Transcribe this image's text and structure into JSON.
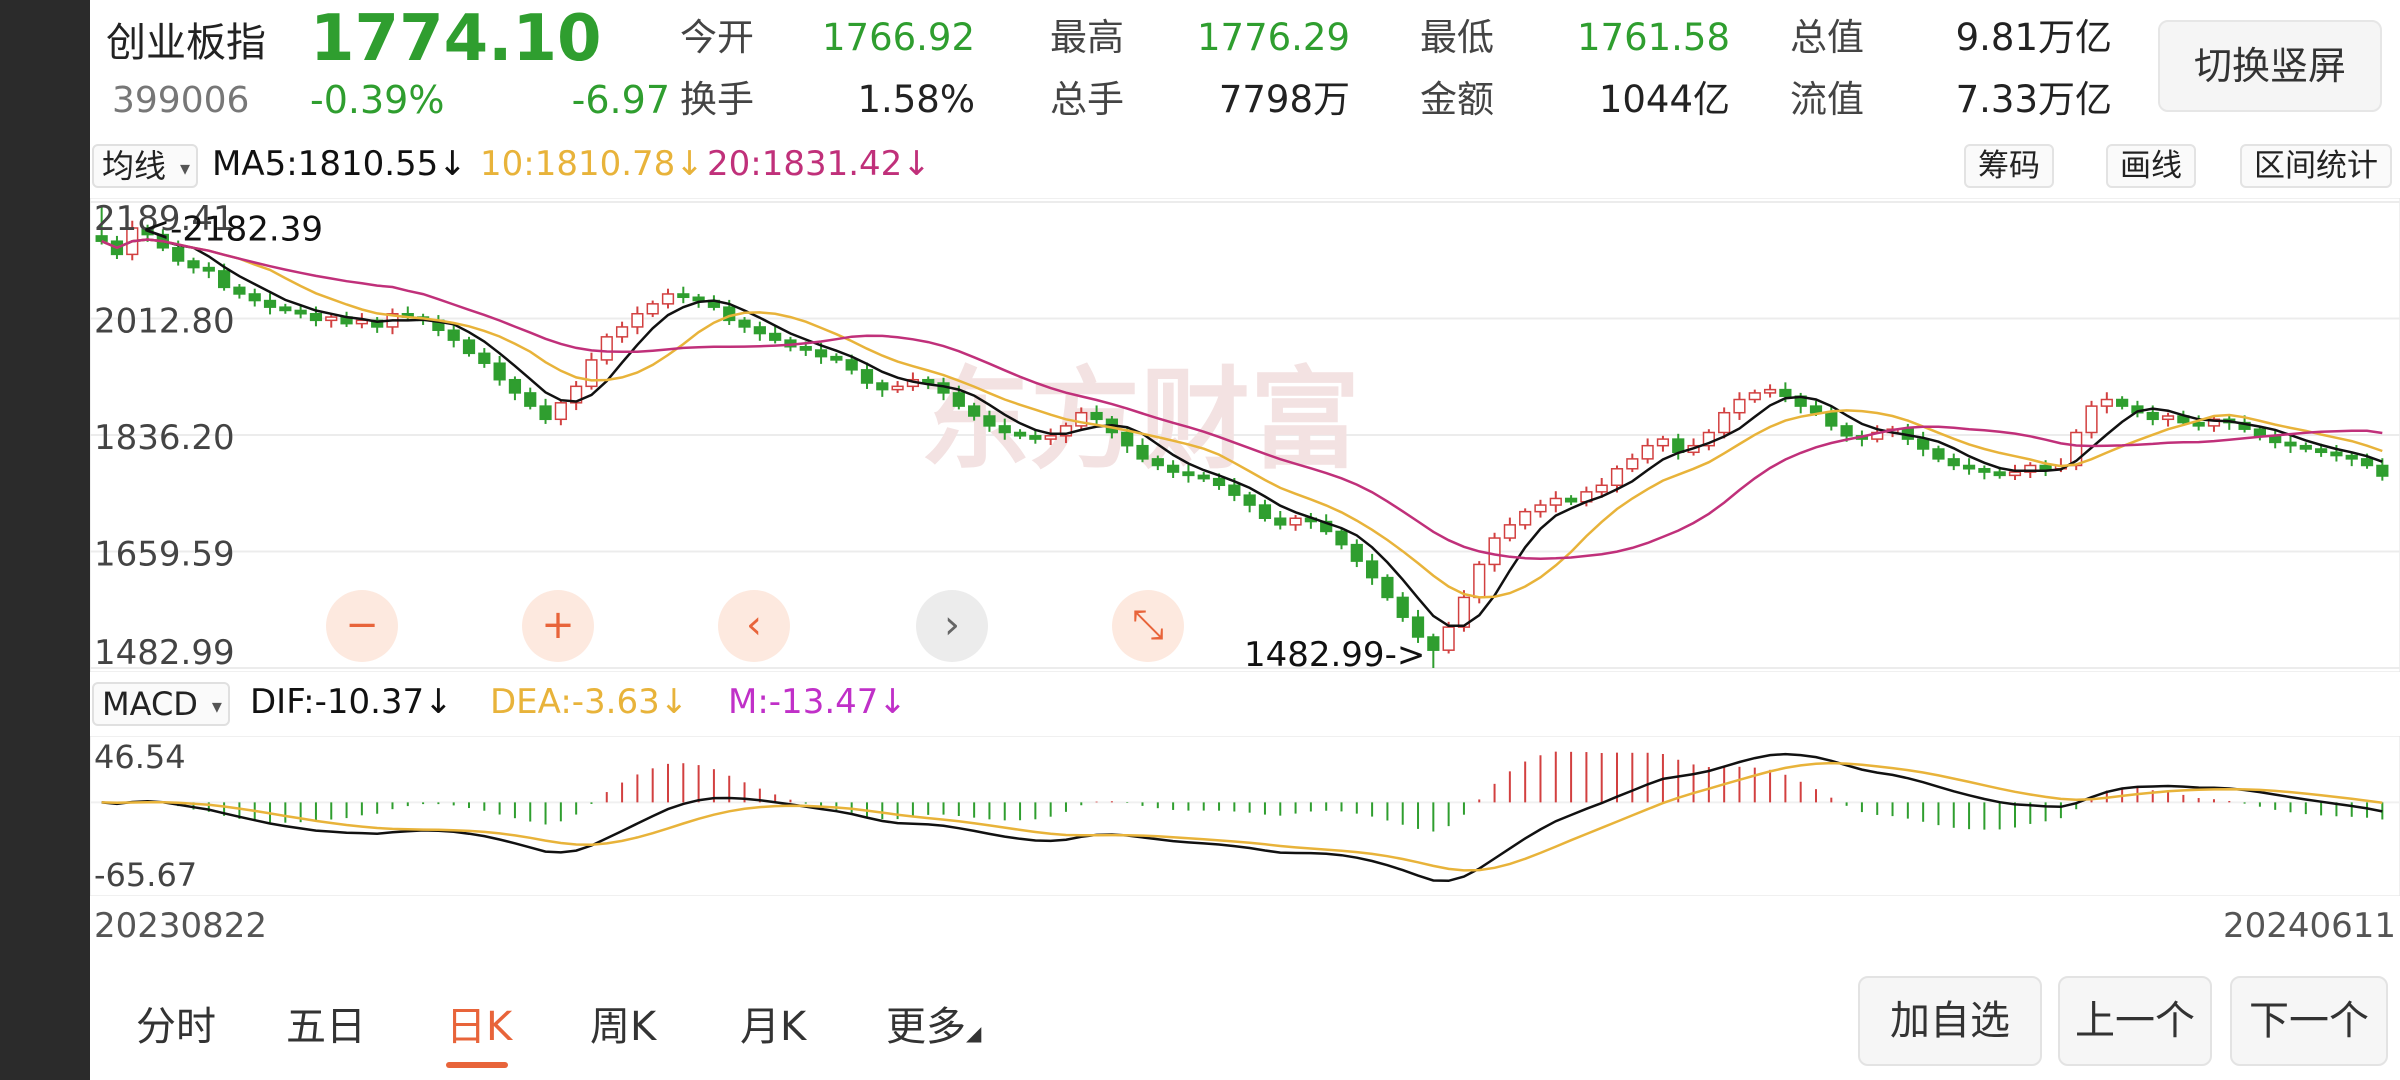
{
  "header": {
    "name": "创业板指",
    "price": "1774.10",
    "code": "399006",
    "change_pct": "-0.39%",
    "change": "-6.97",
    "stats_row1": [
      {
        "label": "今开",
        "value": "1766.92",
        "color": "green"
      },
      {
        "label": "最高",
        "value": "1776.29",
        "color": "green"
      },
      {
        "label": "最低",
        "value": "1761.58",
        "color": "green"
      },
      {
        "label": "总值",
        "value": "9.81万亿",
        "color": "dark"
      }
    ],
    "stats_row2": [
      {
        "label": "换手",
        "value": "1.58%",
        "color": "dark"
      },
      {
        "label": "总手",
        "value": "7798万",
        "color": "dark"
      },
      {
        "label": "金额",
        "value": "1044亿",
        "color": "dark"
      },
      {
        "label": "流值",
        "value": "7.33万亿",
        "color": "dark"
      }
    ],
    "switch_label": "切换竖屏"
  },
  "ma_bar": {
    "selector": "均线",
    "ma5": "MA5:1810.55",
    "ma10": "10:1810.78",
    "ma20": "20:1831.42",
    "arrow": "↓",
    "tools": [
      "筹码",
      "画线",
      "区间统计"
    ]
  },
  "colors": {
    "rise": "#d24040",
    "fall": "#2f9e2f",
    "ma5": "#111111",
    "ma10": "#e8b33a",
    "ma20": "#c0307a",
    "accent": "#e8643a"
  },
  "kline": {
    "y_labels": [
      "2189.41",
      "2012.80",
      "1836.20",
      "1659.59",
      "1482.99"
    ],
    "max_marker": "<-2182.39",
    "min_marker": "1482.99->",
    "watermark": "东方财富"
  },
  "controls": [
    {
      "name": "zoom-out-button",
      "icon": "−",
      "style": "orange"
    },
    {
      "name": "zoom-in-button",
      "icon": "+",
      "style": "orange"
    },
    {
      "name": "scroll-left-button",
      "icon": "‹",
      "style": "orange"
    },
    {
      "name": "scroll-right-button",
      "icon": "›",
      "style": "grey"
    },
    {
      "name": "collapse-button",
      "icon": "⤡",
      "style": "orange"
    }
  ],
  "macd_bar": {
    "selector": "MACD",
    "dif": "DIF:-10.37",
    "dea": "DEA:-3.63",
    "m": "M:-13.47",
    "arrow": "↓",
    "y_top": "46.54",
    "y_bottom": "-65.67"
  },
  "dates": {
    "start": "20230822",
    "end": "20240611"
  },
  "tabs": [
    {
      "label": "分时",
      "active": false
    },
    {
      "label": "五日",
      "active": false
    },
    {
      "label": "日K",
      "active": true
    },
    {
      "label": "周K",
      "active": false
    },
    {
      "label": "月K",
      "active": false
    },
    {
      "label": "更多",
      "active": false
    }
  ],
  "bottom_buttons": [
    "加自选",
    "上一个",
    "下一个"
  ],
  "chart_data": [
    {
      "type": "candlestick",
      "title": "创业板指",
      "x_start": "20230822",
      "x_end": "20240611",
      "ylim": [
        1482.99,
        2189.41
      ],
      "max_value": 2182.39,
      "min_value": 1482.99,
      "close_series": [
        2130,
        2110,
        2150,
        2140,
        2120,
        2100,
        2090,
        2085,
        2060,
        2050,
        2040,
        2030,
        2025,
        2020,
        2010,
        2015,
        2005,
        2010,
        2000,
        2020,
        2015,
        2010,
        1995,
        1980,
        1960,
        1945,
        1920,
        1900,
        1880,
        1860,
        1885,
        1910,
        1950,
        1985,
        2000,
        2020,
        2035,
        2050,
        2045,
        2040,
        2030,
        2010,
        2000,
        1990,
        1980,
        1970,
        1965,
        1955,
        1950,
        1935,
        1915,
        1905,
        1910,
        1920,
        1915,
        1900,
        1880,
        1865,
        1850,
        1840,
        1835,
        1830,
        1835,
        1850,
        1870,
        1860,
        1840,
        1820,
        1800,
        1790,
        1780,
        1775,
        1770,
        1760,
        1745,
        1730,
        1710,
        1700,
        1710,
        1705,
        1690,
        1670,
        1645,
        1620,
        1590,
        1560,
        1530,
        1510,
        1545,
        1590,
        1640,
        1680,
        1700,
        1720,
        1730,
        1740,
        1735,
        1750,
        1760,
        1785,
        1800,
        1820,
        1830,
        1810,
        1820,
        1840,
        1870,
        1890,
        1900,
        1905,
        1895,
        1880,
        1870,
        1850,
        1835,
        1830,
        1840,
        1845,
        1830,
        1815,
        1800,
        1790,
        1785,
        1780,
        1775,
        1780,
        1790,
        1785,
        1790,
        1840,
        1880,
        1890,
        1880,
        1870,
        1860,
        1865,
        1855,
        1850,
        1860,
        1855,
        1845,
        1835,
        1825,
        1820,
        1815,
        1810,
        1805,
        1800,
        1790,
        1774
      ]
    },
    {
      "type": "line",
      "series": [
        {
          "name": "MA5",
          "value_latest": 1810.55
        },
        {
          "name": "10",
          "value_latest": 1810.78
        },
        {
          "name": "20",
          "value_latest": 1831.42
        }
      ]
    },
    {
      "type": "bar",
      "title": "MACD",
      "ylim": [
        -65.67,
        46.54
      ],
      "series": [
        {
          "name": "DIF",
          "value_latest": -10.37
        },
        {
          "name": "DEA",
          "value_latest": -3.63
        },
        {
          "name": "M",
          "value_latest": -13.47
        }
      ]
    }
  ]
}
